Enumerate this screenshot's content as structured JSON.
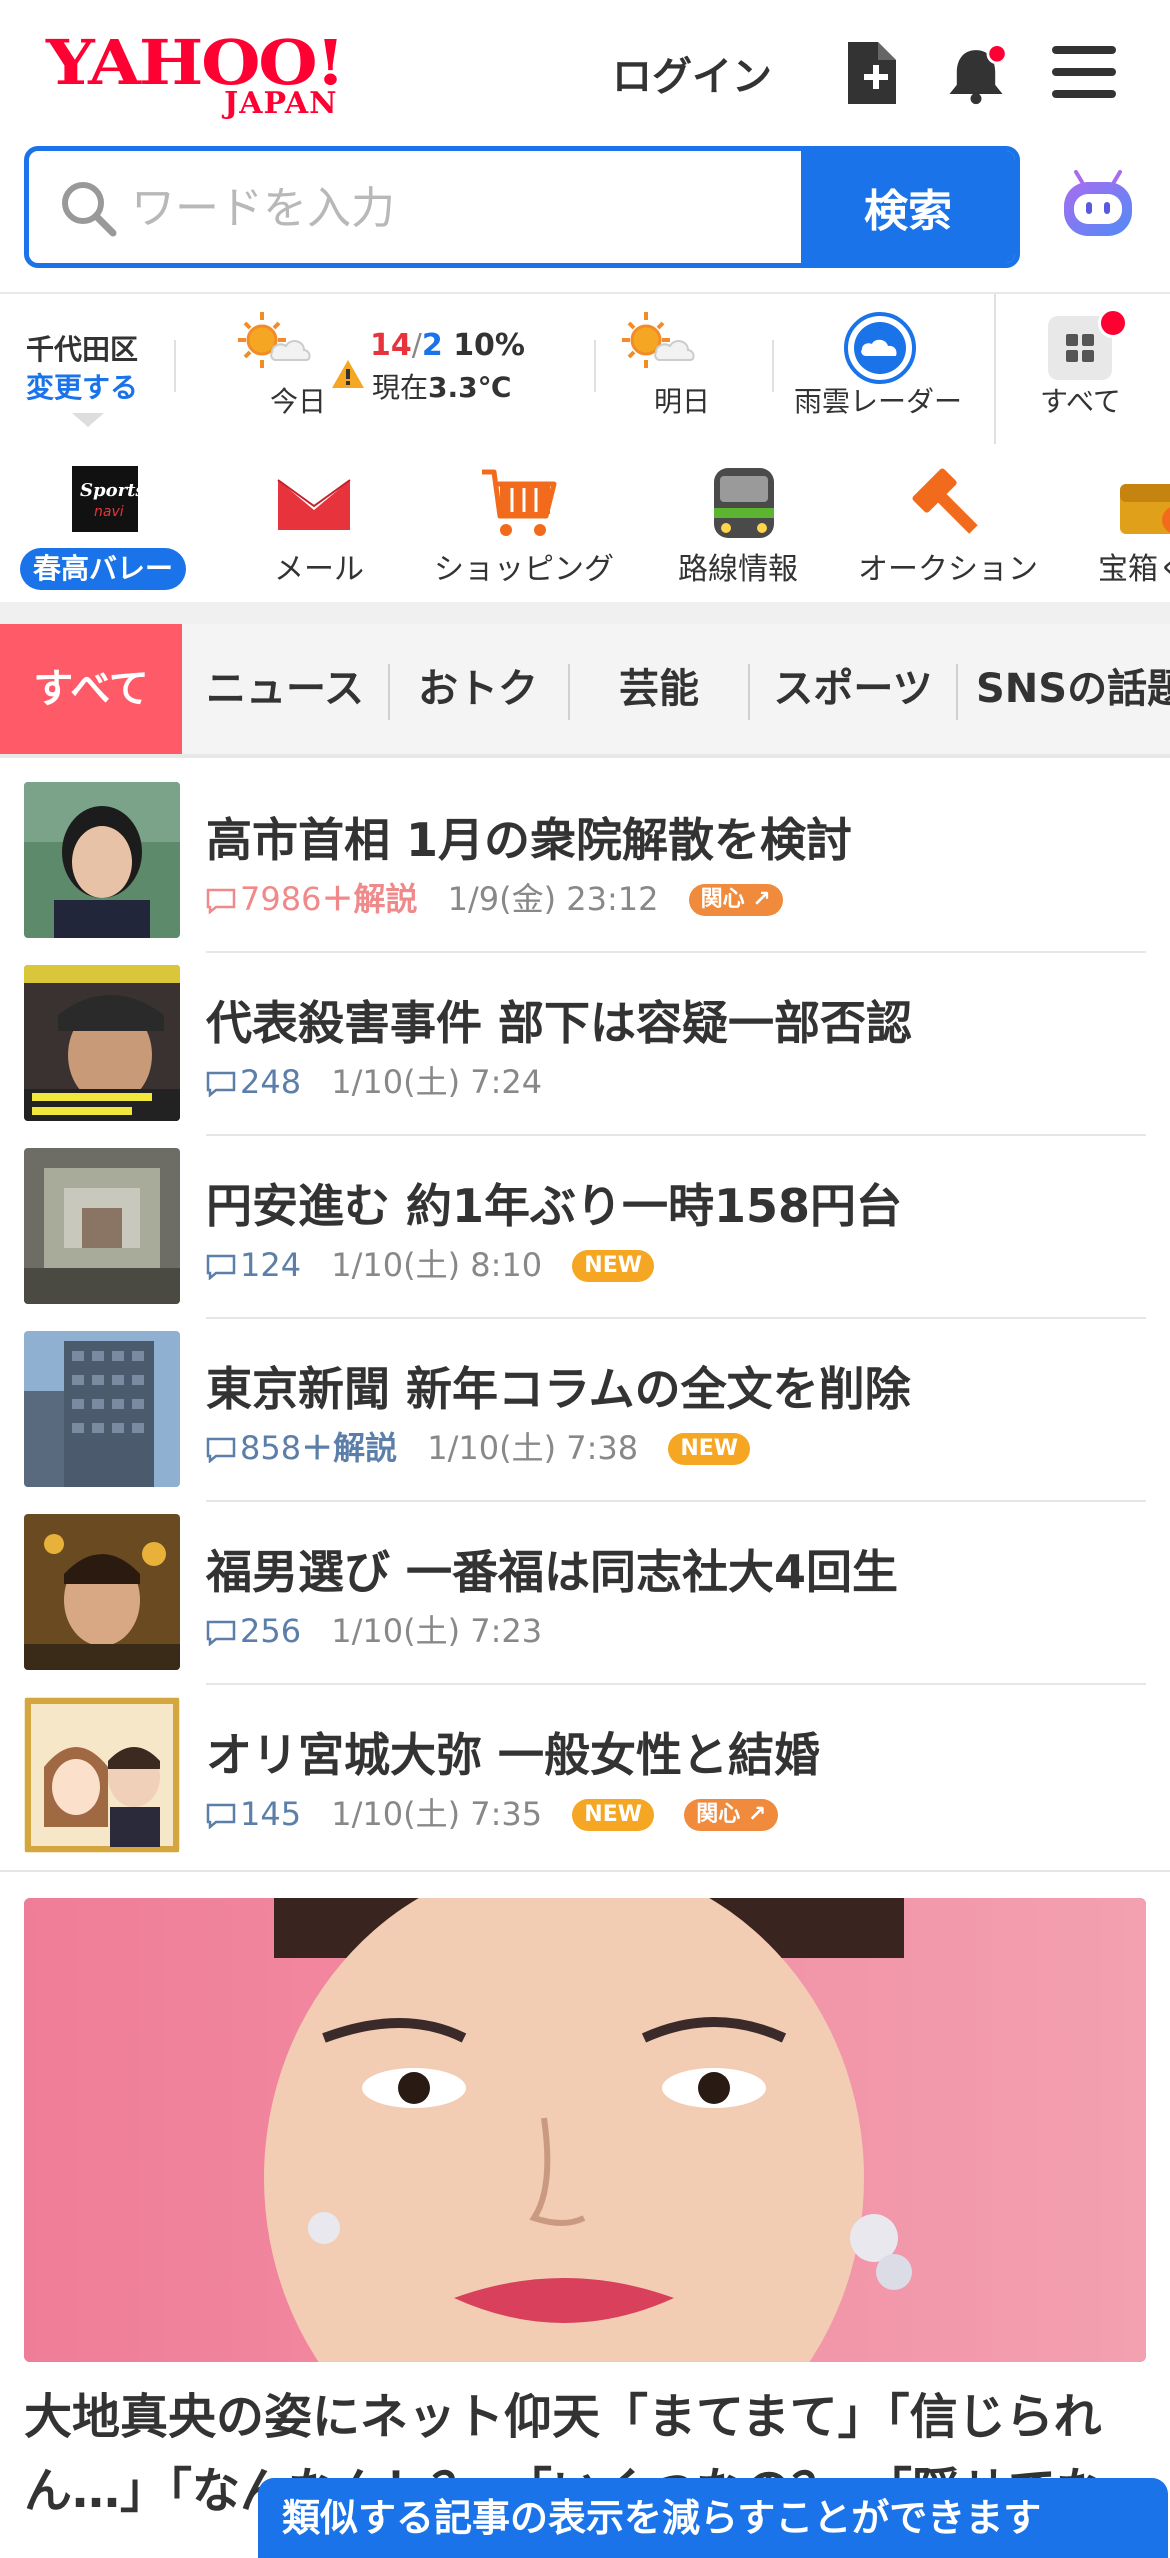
{
  "header": {
    "logo_main": "YAHOO!",
    "logo_sub": "JAPAN",
    "login_label": "ログイン"
  },
  "search": {
    "placeholder": "ワードを入力",
    "button_label": "検索"
  },
  "info_bar": {
    "location_name": "千代田区",
    "location_change": "変更する",
    "today_high": "14",
    "today_low": "2",
    "today_rain": "10%",
    "current_label": "現在",
    "current_temp": "3.3℃",
    "today_label": "今日",
    "tomorrow_label": "明日",
    "radar_label": "雨雲レーダー",
    "all_label": "すべて"
  },
  "services": [
    {
      "label": "春高バレー",
      "icon": "sports-navi-icon"
    },
    {
      "label": "メール",
      "icon": "mail-icon"
    },
    {
      "label": "ショッピング",
      "icon": "shopping-cart-icon"
    },
    {
      "label": "路線情報",
      "icon": "train-icon"
    },
    {
      "label": "オークション",
      "icon": "auction-hammer-icon"
    },
    {
      "label": "宝箱く",
      "icon": "treasure-box-icon"
    }
  ],
  "tabs": [
    {
      "label": "すべて",
      "active": true
    },
    {
      "label": "ニュース"
    },
    {
      "label": "おトク"
    },
    {
      "label": "芸能"
    },
    {
      "label": "スポーツ"
    },
    {
      "label": "SNSの話題"
    }
  ],
  "news": [
    {
      "title": "高市首相 1月の衆院解散を検討",
      "comments": "7986",
      "kaisetsu": "＋解説",
      "date": "1/9(金) 23:12",
      "badge_hot": "関心",
      "hot": true
    },
    {
      "title": "代表殺害事件 部下は容疑一部否認",
      "comments": "248",
      "date": "1/10(土) 7:24"
    },
    {
      "title": "円安進む 約1年ぶり一時158円台",
      "comments": "124",
      "date": "1/10(土) 8:10",
      "badge_new": "NEW"
    },
    {
      "title": "東京新聞 新年コラムの全文を削除",
      "comments": "858",
      "kaisetsu": "＋解説",
      "date": "1/10(土) 7:38",
      "badge_new": "NEW"
    },
    {
      "title": "福男選び 一番福は同志社大4回生",
      "comments": "256",
      "date": "1/10(土) 7:23"
    },
    {
      "title": "オリ宮城大弥 一般女性と結婚",
      "comments": "145",
      "date": "1/10(土) 7:35",
      "badge_new": "NEW",
      "badge_hot": "関心"
    }
  ],
  "feature": {
    "headline": "大地真央の姿にネット仰天「まてまて」「信じられん…」「なんなん！？」「いくつなの？」「隠せてな"
  },
  "toast": {
    "text": "類似する記事の表示を減らすことができます"
  },
  "colors": {
    "brand_red": "#ff0033",
    "accent_blue": "#1a73e8",
    "tab_active": "#ff5a67",
    "badge_new": "#f5a623",
    "badge_hot": "#f08a3c"
  }
}
